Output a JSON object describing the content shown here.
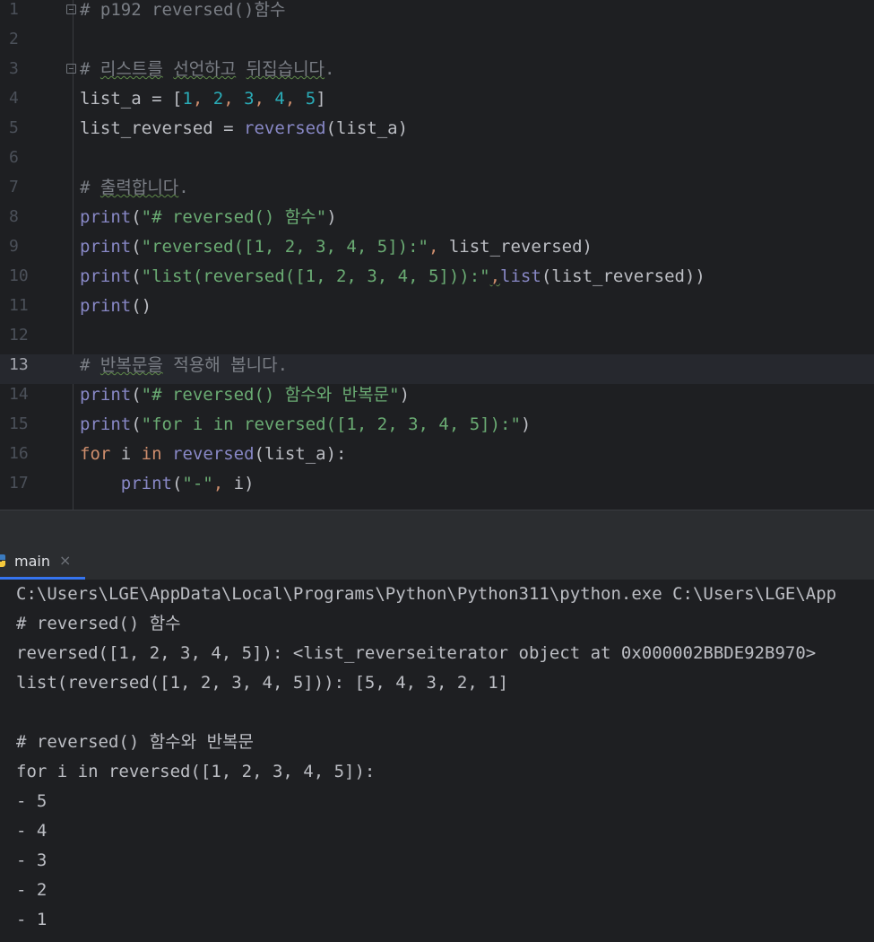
{
  "editor": {
    "lines": [
      {
        "num": "1",
        "parts": [
          {
            "t": "# p192 reversed()함수",
            "c": "c-comment"
          }
        ],
        "fold": true
      },
      {
        "num": "2",
        "parts": []
      },
      {
        "num": "3",
        "parts": [
          {
            "t": "# ",
            "c": "c-comment"
          },
          {
            "t": "리스트를",
            "c": "c-comment squiggle"
          },
          {
            "t": " ",
            "c": "c-comment"
          },
          {
            "t": "선언하고",
            "c": "c-comment squiggle"
          },
          {
            "t": " ",
            "c": "c-comment"
          },
          {
            "t": "뒤집습니다",
            "c": "c-comment squiggle"
          },
          {
            "t": ".",
            "c": "c-comment"
          }
        ],
        "fold": true
      },
      {
        "num": "4",
        "parts": [
          {
            "t": "list_a = [",
            "c": ""
          },
          {
            "t": "1",
            "c": "c-num"
          },
          {
            "t": ", ",
            "c": "c-orange"
          },
          {
            "t": "2",
            "c": "c-num"
          },
          {
            "t": ", ",
            "c": "c-orange"
          },
          {
            "t": "3",
            "c": "c-num"
          },
          {
            "t": ", ",
            "c": "c-orange"
          },
          {
            "t": "4",
            "c": "c-num"
          },
          {
            "t": ", ",
            "c": "c-orange"
          },
          {
            "t": "5",
            "c": "c-num"
          },
          {
            "t": "]",
            "c": ""
          }
        ]
      },
      {
        "num": "5",
        "parts": [
          {
            "t": "list_reversed = ",
            "c": ""
          },
          {
            "t": "reversed",
            "c": "c-builtin"
          },
          {
            "t": "(list_a)",
            "c": ""
          }
        ]
      },
      {
        "num": "6",
        "parts": []
      },
      {
        "num": "7",
        "parts": [
          {
            "t": "# ",
            "c": "c-comment"
          },
          {
            "t": "출력합니다",
            "c": "c-comment squiggle"
          },
          {
            "t": ".",
            "c": "c-comment"
          }
        ]
      },
      {
        "num": "8",
        "parts": [
          {
            "t": "print",
            "c": "c-builtin"
          },
          {
            "t": "(",
            "c": ""
          },
          {
            "t": "\"# reversed() 함수\"",
            "c": "c-str"
          },
          {
            "t": ")",
            "c": ""
          }
        ]
      },
      {
        "num": "9",
        "parts": [
          {
            "t": "print",
            "c": "c-builtin"
          },
          {
            "t": "(",
            "c": ""
          },
          {
            "t": "\"reversed([1, 2, 3, 4, 5]):\"",
            "c": "c-str"
          },
          {
            "t": ", ",
            "c": "c-orange"
          },
          {
            "t": "list_reversed)",
            "c": ""
          }
        ]
      },
      {
        "num": "10",
        "parts": [
          {
            "t": "print",
            "c": "c-builtin"
          },
          {
            "t": "(",
            "c": ""
          },
          {
            "t": "\"list(reversed([1, 2, 3, 4, 5])):\"",
            "c": "c-str"
          },
          {
            "t": ",",
            "c": "c-orange squiggle"
          },
          {
            "t": "list",
            "c": "c-builtin"
          },
          {
            "t": "(list_reversed))",
            "c": ""
          }
        ]
      },
      {
        "num": "11",
        "parts": [
          {
            "t": "print",
            "c": "c-builtin"
          },
          {
            "t": "()",
            "c": ""
          }
        ]
      },
      {
        "num": "12",
        "parts": []
      },
      {
        "num": "13",
        "parts": [
          {
            "t": "# ",
            "c": "c-comment"
          },
          {
            "t": "반복문을",
            "c": "c-comment squiggle"
          },
          {
            "t": " 적용해 봅니다.",
            "c": "c-comment"
          }
        ],
        "current": true
      },
      {
        "num": "14",
        "parts": [
          {
            "t": "print",
            "c": "c-builtin"
          },
          {
            "t": "(",
            "c": ""
          },
          {
            "t": "\"# reversed() 함수와 반복문\"",
            "c": "c-str"
          },
          {
            "t": ")",
            "c": ""
          }
        ]
      },
      {
        "num": "15",
        "parts": [
          {
            "t": "print",
            "c": "c-builtin"
          },
          {
            "t": "(",
            "c": ""
          },
          {
            "t": "\"for i in reversed([1, 2, 3, 4, 5]):\"",
            "c": "c-str"
          },
          {
            "t": ")",
            "c": ""
          }
        ]
      },
      {
        "num": "16",
        "parts": [
          {
            "t": "for",
            "c": "c-kw"
          },
          {
            "t": " i ",
            "c": ""
          },
          {
            "t": "in",
            "c": "c-kw"
          },
          {
            "t": " ",
            "c": ""
          },
          {
            "t": "reversed",
            "c": "c-builtin"
          },
          {
            "t": "(list_a):",
            "c": ""
          }
        ]
      },
      {
        "num": "17",
        "parts": [
          {
            "t": "    ",
            "c": ""
          },
          {
            "t": "print",
            "c": "c-builtin"
          },
          {
            "t": "(",
            "c": ""
          },
          {
            "t": "\"-\"",
            "c": "c-str"
          },
          {
            "t": ", ",
            "c": "c-orange"
          },
          {
            "t": "i)",
            "c": ""
          }
        ]
      }
    ]
  },
  "run_panel": {
    "tab_label": "main",
    "tab_close": "×",
    "output": [
      "C:\\Users\\LGE\\AppData\\Local\\Programs\\Python\\Python311\\python.exe C:\\Users\\LGE\\App",
      "# reversed() 함수",
      "reversed([1, 2, 3, 4, 5]): <list_reverseiterator object at 0x000002BBDE92B970>",
      "list(reversed([1, 2, 3, 4, 5])): [5, 4, 3, 2, 1]",
      "",
      "# reversed() 함수와 반복문",
      "for i in reversed([1, 2, 3, 4, 5]):",
      "- 5",
      "- 4",
      "- 3",
      "- 2",
      "- 1"
    ]
  }
}
